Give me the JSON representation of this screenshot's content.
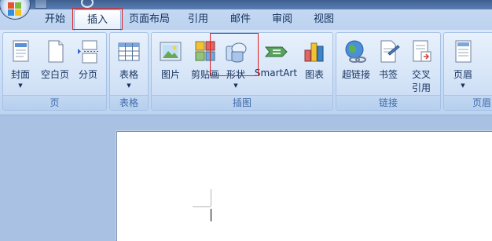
{
  "tabs": [
    {
      "id": "home",
      "label": "开始"
    },
    {
      "id": "insert",
      "label": "插入",
      "active": true
    },
    {
      "id": "layout",
      "label": "页面布局"
    },
    {
      "id": "references",
      "label": "引用"
    },
    {
      "id": "mailings",
      "label": "邮件"
    },
    {
      "id": "review",
      "label": "审阅"
    },
    {
      "id": "view",
      "label": "视图"
    }
  ],
  "groups": {
    "pages": {
      "label": "页",
      "commands": [
        {
          "label": "封面",
          "icon": "cover-page-icon",
          "has_dropdown": true
        },
        {
          "label": "空白页",
          "icon": "blank-page-icon",
          "has_dropdown": false
        },
        {
          "label": "分页",
          "icon": "page-break-icon",
          "has_dropdown": false
        }
      ]
    },
    "tables": {
      "label": "表格",
      "commands": [
        {
          "label": "表格",
          "icon": "table-icon",
          "has_dropdown": true
        }
      ]
    },
    "illustrations": {
      "label": "插图",
      "commands": [
        {
          "label": "图片",
          "icon": "picture-icon",
          "has_dropdown": false
        },
        {
          "label": "剪贴画",
          "icon": "clip-art-icon",
          "has_dropdown": false
        },
        {
          "label": "形状",
          "icon": "shapes-icon",
          "has_dropdown": true
        },
        {
          "label": "SmartArt",
          "icon": "smartart-icon",
          "has_dropdown": false
        },
        {
          "label": "图表",
          "icon": "chart-icon",
          "has_dropdown": false
        }
      ]
    },
    "links": {
      "label": "链接",
      "commands": [
        {
          "label": "超链接",
          "icon": "hyperlink-icon",
          "has_dropdown": false
        },
        {
          "label": "书签",
          "icon": "bookmark-icon",
          "has_dropdown": false
        },
        {
          "label": "交叉",
          "label2": "引用",
          "icon": "cross-reference-icon",
          "has_dropdown": false
        }
      ]
    },
    "header_footer": {
      "label": "页眉",
      "commands": [
        {
          "label": "页眉",
          "icon": "header-icon",
          "has_dropdown": true
        }
      ]
    }
  },
  "colors": {
    "highlight": "#e02020",
    "group_label": "#3e6aaa",
    "text": "#15325e"
  },
  "dropdown_glyph": "▼"
}
